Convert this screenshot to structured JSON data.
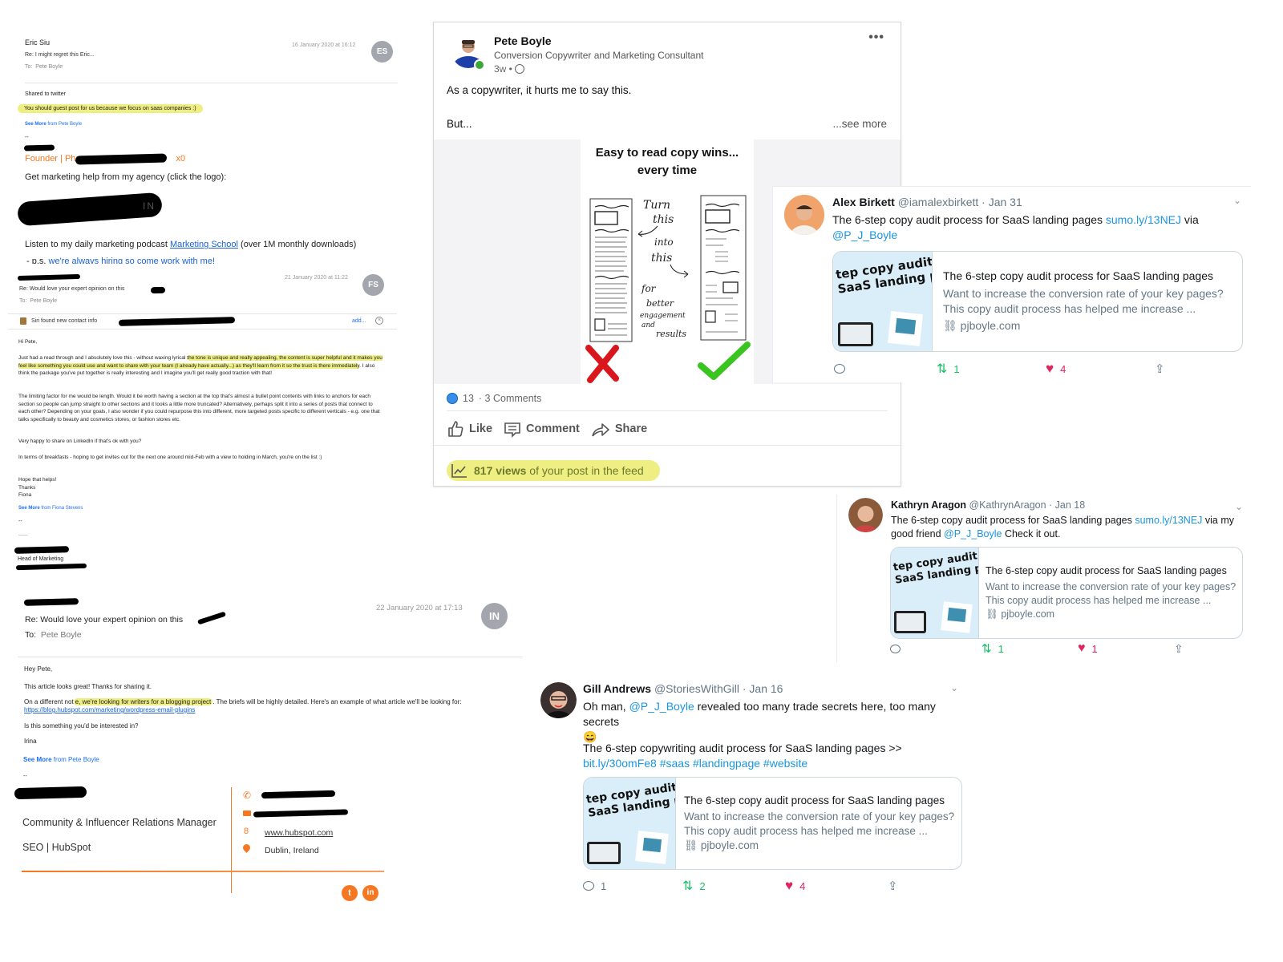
{
  "email1": {
    "from": "Eric Siu",
    "subject": "Re: I might regret this Eric...",
    "to_label": "To:",
    "to": "Pete Boyle",
    "date": "16 January 2020 at 16:12",
    "avatar": "ES",
    "body_line1": "Shared to twitter",
    "highlight": "You should guest post for us because we focus on saas companies :)",
    "see_more_bold": "See More",
    "see_more_rest": " from Pete Boyle",
    "dash": "--",
    "sig_title": "Founder | Ph:",
    "sig_ext": "x0",
    "agency_line": "Get marketing help from my agency (click the logo):",
    "podcast_pre": "Listen to my daily marketing podcast ",
    "podcast_link": "Marketing School",
    "podcast_post": " (over 1M monthly downloads)",
    "ps_pre": "- p.s. ",
    "ps_link": "we're always hiring so come work with me!"
  },
  "email2": {
    "subject": "Re: Would love your expert opinion on this",
    "to_label": "To:",
    "to": "Pete Boyle",
    "date": "21 January 2020 at 11:22",
    "avatar": "FS",
    "siri_text": "Siri found new contact info",
    "siri_add": "add...",
    "greeting": "Hi Pete,",
    "p1_pre": "Just had a read through and I absolutely love this - without waxing lyrical ",
    "p1_hl": "the tone is unique and really appealing, the content is super helpful and it makes you feel like something you could use and want to share with your team (I already have actually...) as they'll learn from it so the trust is there immediately",
    "p1_post": ". I also think the package you've put together is really interesting and I imagine you'll get really good traction with that!",
    "p2": "The limiting factor for me would be length. Would it be worth having a section at the top that's almost a bullet point contents with links to anchors for each section so people can jump straight to other sections and it looks a little more truncated? Alternatively, perhaps split it into a series of posts that connect to each other? Depending on your goals, I also wonder if you could repurpose this into different, more targeted posts specific to different verticals - e.g. one that talks specifically to beauty and cosmetics stores, or fashion stores etc.",
    "p3": "Very happy to share on LinkedIn if that's ok with you?",
    "p4": "In terms of breakfasts - hoping to get invites out for the next one around mid-Feb with a view to holding in March, you're on the list :)",
    "sign1": "Hope that helps!",
    "sign2": "Thanks",
    "sign3": "Fiona",
    "see_more_bold": "See More",
    "see_more_rest": " from Fiona Stevens",
    "dash": "--",
    "dash2": "___",
    "role": "Head of Marketing"
  },
  "email3": {
    "subject": "Re: Would love your expert opinion on this",
    "to_label": "To:",
    "to": "Pete Boyle",
    "date": "22 January 2020 at 17:13",
    "avatar": "IN",
    "greeting": "Hey Pete,",
    "p1": "This article looks great! Thanks for sharing it.",
    "p2_pre": "On a different not",
    "p2_hl": "e, we're looking for writers for a blogging project",
    "p2_post": ". The briefs will be highly detailed. Here's an example of what article we'll be looking for: ",
    "p2_link": "https://blog.hubspot.com/marketing/wordpress-email-plugins",
    "p3": "Is this something you'd be interested in?",
    "sign": "Irina",
    "see_more_bold": "See More",
    "see_more_rest": " from Pete Boyle",
    "dash": "--",
    "role": "Community & Influencer Relations Manager",
    "dept": "SEO | HubSpot",
    "website": "www.hubspot.com",
    "location": "Dublin, Ireland",
    "brand_color": "#f57722"
  },
  "linkedin": {
    "name": "Pete Boyle",
    "headline": "Conversion Copywriter and Marketing Consultant",
    "time": "3w •",
    "more": "•••",
    "text1": "As a copywriter, it hurts me to say this.",
    "text2": "But...",
    "see_more": "...see more",
    "image_title_1": "Easy to read copy wins...",
    "image_title_2": "every time",
    "sketch_note": [
      "Turn",
      "this",
      "into",
      "this",
      "for",
      "better",
      "engagement",
      "and",
      "results"
    ],
    "reactions": "13",
    "comments": "· 3 Comments",
    "actions": [
      "Like",
      "Comment",
      "Share"
    ],
    "views_bold": "817 views",
    "views_rest": " of your post in the feed",
    "online_color": "#3ca736"
  },
  "tweets": [
    {
      "name": "Alex Birkett",
      "handle": "@iamalexbirkett",
      "date": "· Jan 31",
      "text_pre": "The 6-step copy audit process for SaaS landing pages ",
      "link": "sumo.ly/13NEJ",
      "text_mid": " via",
      "mention": "@P_J_Boyle",
      "text_post": "",
      "card_thumb_1": "tep copy audit p",
      "card_thumb_2": "SaaS landing pa",
      "card_title": "The 6-step copy audit process for SaaS landing pages",
      "card_desc_1": "Want to increase the conversion rate of your key pages?",
      "card_desc_2": "This copy audit process has helped me increase ...",
      "card_domain": "pjboyle.com",
      "replies": "",
      "retweets": "1",
      "likes": "4"
    },
    {
      "name": "Kathryn Aragon",
      "handle": "@KathrynAragon",
      "date": "· Jan 18",
      "text_pre": "The 6-step copy audit process for SaaS landing pages ",
      "link": "sumo.ly/13NEJ",
      "text_mid": " via my good friend ",
      "mention": "@P_J_Boyle",
      "text_post": " Check it out.",
      "card_thumb_1": "tep copy audit p",
      "card_thumb_2": "SaaS landing pa",
      "card_title": "The 6-step copy audit process for SaaS landing pages",
      "card_desc_1": "Want to increase the conversion rate of your key pages?",
      "card_desc_2": "This copy audit process has helped me increase ...",
      "card_domain": "pjboyle.com",
      "replies": "",
      "retweets": "1",
      "likes": "1"
    },
    {
      "name": "Gill Andrews",
      "handle": "@StoriesWithGill",
      "date": "· Jan 16",
      "text_pre": "Oh man, ",
      "mention": "@P_J_Boyle",
      "text_mid": " revealed too many trade secrets here, too many secrets",
      "emoji": "😄",
      "text_2": "The 6-step copywriting audit process for SaaS landing pages >>",
      "link": "bit.ly/30omFe8 #saas #landingpage #website",
      "card_thumb_1": "tep copy audit p",
      "card_thumb_2": "SaaS landing pa",
      "card_title": "The 6-step copy audit process for SaaS landing pages",
      "card_desc_1": "Want to increase the conversion rate of your key pages?",
      "card_desc_2": "This copy audit process has helped me increase ...",
      "card_domain": "pjboyle.com",
      "replies": "1",
      "retweets": "2",
      "likes": "4"
    }
  ],
  "icons": {
    "link": "🔗",
    "emoji_note": "grinning-face"
  }
}
